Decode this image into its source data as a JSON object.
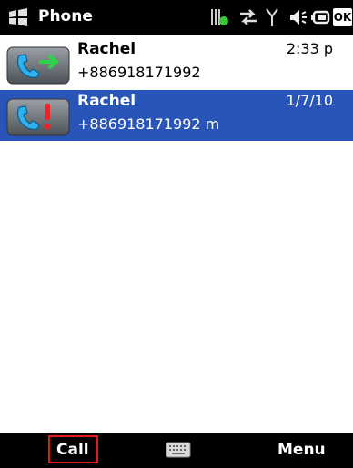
{
  "titlebar": {
    "title": "Phone",
    "icons": [
      "windows-start-icon",
      "data-connection-icon",
      "sync-arrows-icon",
      "signal-icon",
      "speaker-icon",
      "battery-icon",
      "ok-icon"
    ],
    "ok_label": "OK"
  },
  "calls": [
    {
      "name": "Rachel",
      "number": "+886918171992",
      "time": "2:33 p",
      "type": "outgoing",
      "icon": "outgoing-call-icon",
      "selected": false
    },
    {
      "name": "Rachel",
      "number": "+886918171992 m",
      "time": "1/7/10",
      "type": "missed",
      "icon": "missed-call-icon",
      "selected": true
    }
  ],
  "softkeys": {
    "left": "Call",
    "right": "Menu",
    "center_icon": "keyboard-icon"
  },
  "colors": {
    "selection": "#2a55b8",
    "bar": "#000000",
    "highlight_box": "#e01a1a"
  }
}
